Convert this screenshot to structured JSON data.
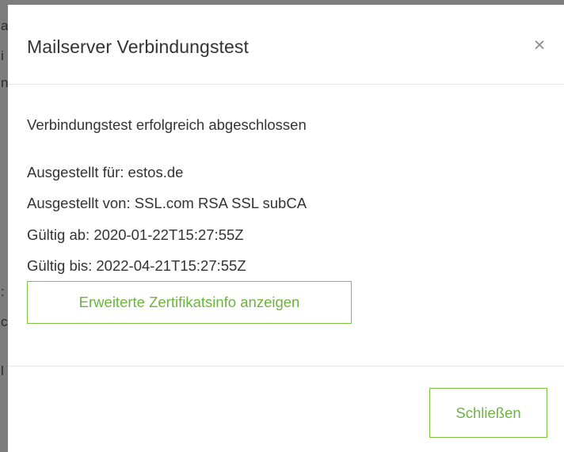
{
  "dialog": {
    "title": "Mailserver Verbindungstest",
    "close_icon": "×"
  },
  "body": {
    "status": "Verbindungstest erfolgreich abgeschlossen",
    "certificate": {
      "issued_to": "Ausgestellt für: estos.de",
      "issued_by": "Ausgestellt von: SSL.com RSA SSL subCA",
      "valid_from": "Gültig ab: 2020-01-22T15:27:55Z",
      "valid_to": "Gültig bis: 2022-04-21T15:27:55Z"
    },
    "details_button": "Erweiterte Zertifikatsinfo anzeigen"
  },
  "footer": {
    "close_button": "Schließen"
  },
  "colors": {
    "accent": "#6cb33f",
    "accent_border": "#7cc242",
    "text": "#333333",
    "divider": "#e5e5e5",
    "backdrop": "#7d7d7d"
  }
}
